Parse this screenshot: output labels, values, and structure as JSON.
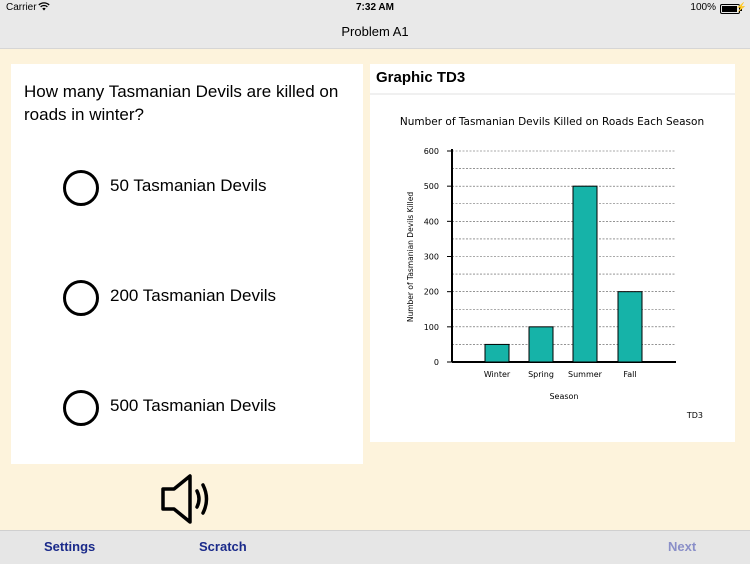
{
  "status_bar": {
    "carrier": "Carrier",
    "time": "7:32 AM",
    "battery": "100%"
  },
  "nav": {
    "title": "Problem A1"
  },
  "question": {
    "text": "How many Tasmanian Devils are killed on roads in winter?",
    "options": [
      {
        "label": "50 Tasmanian Devils"
      },
      {
        "label": "200 Tasmanian Devils"
      },
      {
        "label": "500 Tasmanian Devils"
      }
    ]
  },
  "graphic": {
    "heading": "Graphic TD3",
    "code": "TD3"
  },
  "chart_data": {
    "type": "bar",
    "title": "Number of Tasmanian Devils Killed on Roads Each Season",
    "xlabel": "Season",
    "ylabel": "Number of Tasmanian Devils Killed",
    "categories": [
      "Winter",
      "Spring",
      "Summer",
      "Fall"
    ],
    "values": [
      50,
      100,
      500,
      200
    ],
    "ylim": [
      0,
      600
    ],
    "yticks": [
      0,
      100,
      200,
      300,
      400,
      500,
      600
    ],
    "grid": "horizontal dashed, every 50",
    "bar_color": "#16b3a8"
  },
  "toolbar": {
    "settings": "Settings",
    "scratch": "Scratch",
    "next": "Next"
  },
  "icons": {
    "speaker": "speaker-icon",
    "wifi": "wifi-icon",
    "battery": "battery-icon"
  },
  "colors": {
    "background": "#fdf3dc",
    "toolbar_text": "#1a2a8a",
    "disabled_text": "#8a8fc8"
  }
}
